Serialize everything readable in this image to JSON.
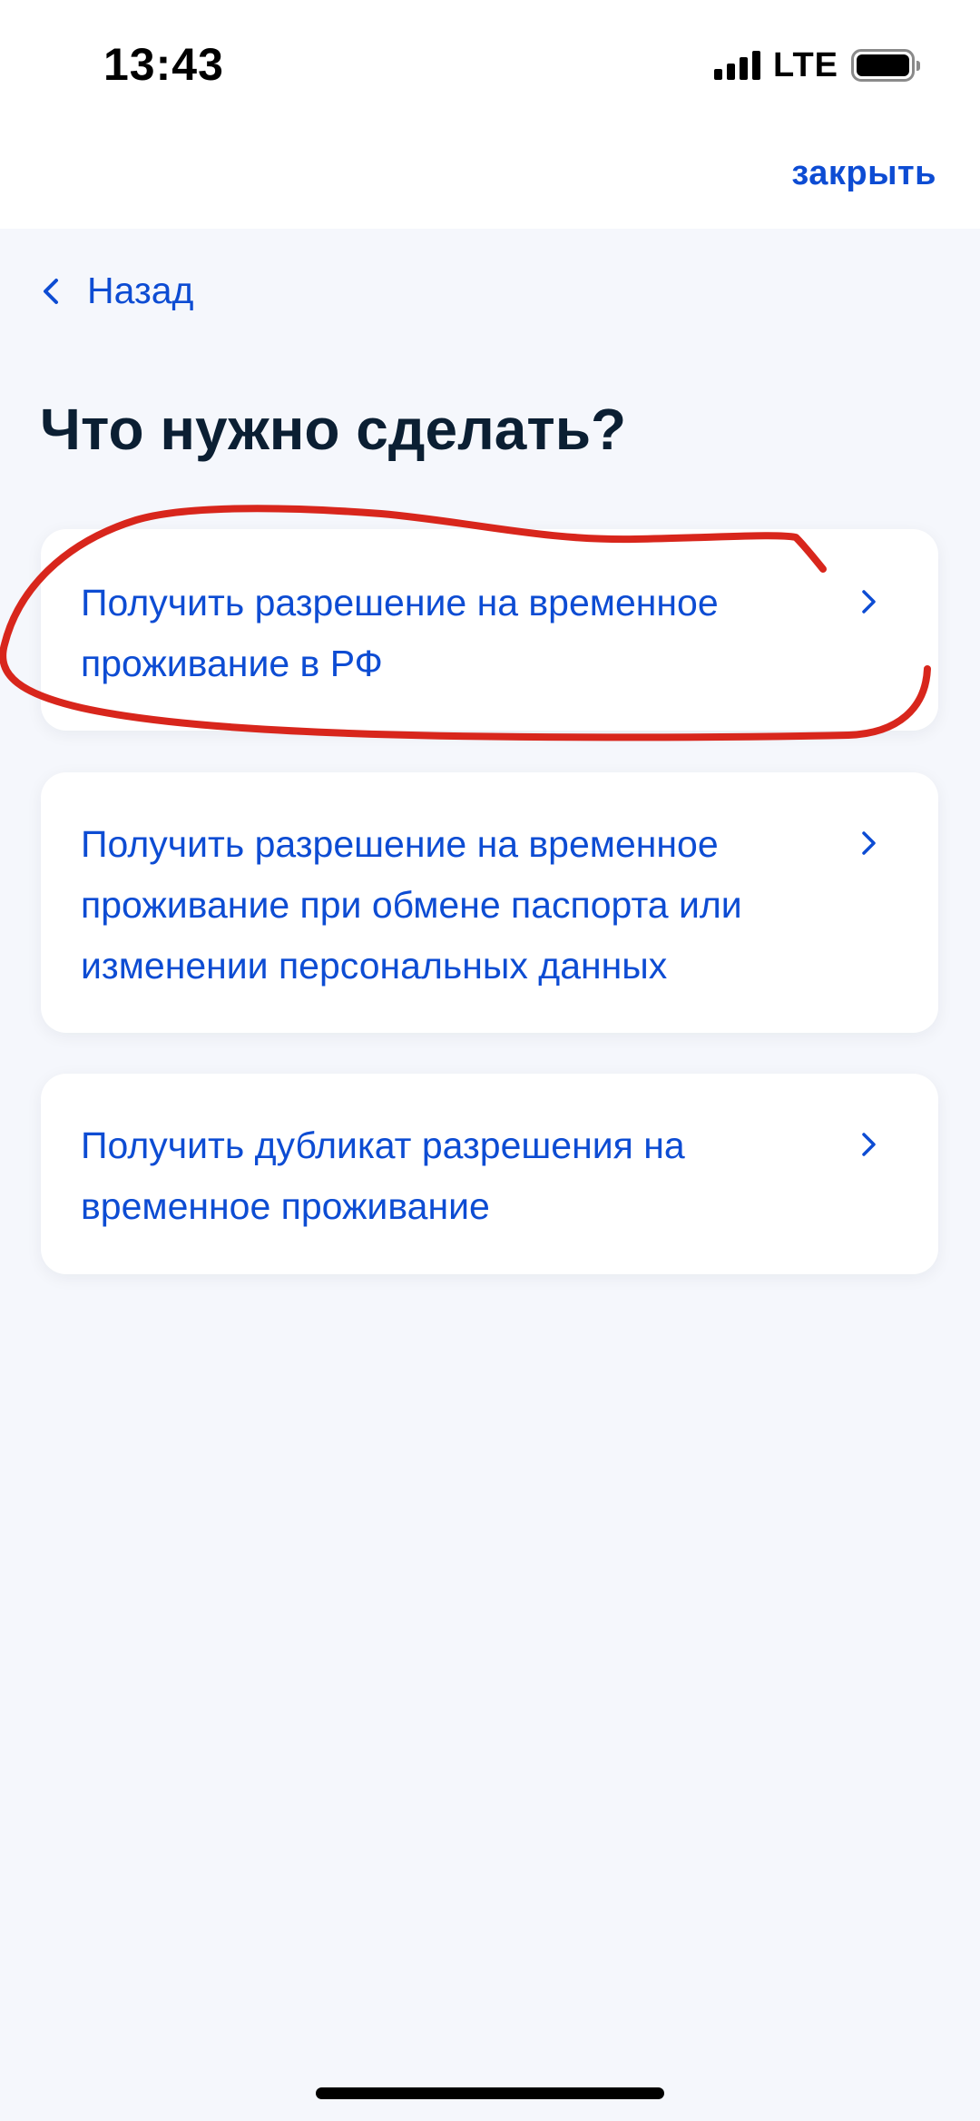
{
  "status_bar": {
    "time": "13:43",
    "network": "LTE",
    "signal_bars": 4
  },
  "header": {
    "close_label": "закрыть"
  },
  "navigation": {
    "back_label": "Назад"
  },
  "page": {
    "title": "Что нужно сделать?"
  },
  "options": [
    {
      "label": "Получить разрешение на временное проживание в РФ",
      "highlighted": true
    },
    {
      "label": "Получить разрешение на временное проживание при обмене паспорта или изменении персональных данных",
      "highlighted": false
    },
    {
      "label": "Получить дубликат разрешения на временное проживание",
      "highlighted": false
    }
  ],
  "colors": {
    "accent": "#0d4cd3",
    "title_text": "#0b1f33",
    "page_background": "#f5f7fc",
    "card_background": "#ffffff",
    "annotation_stroke": "#d8261c"
  },
  "icons": {
    "back": "chevron-left-icon",
    "option": "chevron-right-icon"
  }
}
